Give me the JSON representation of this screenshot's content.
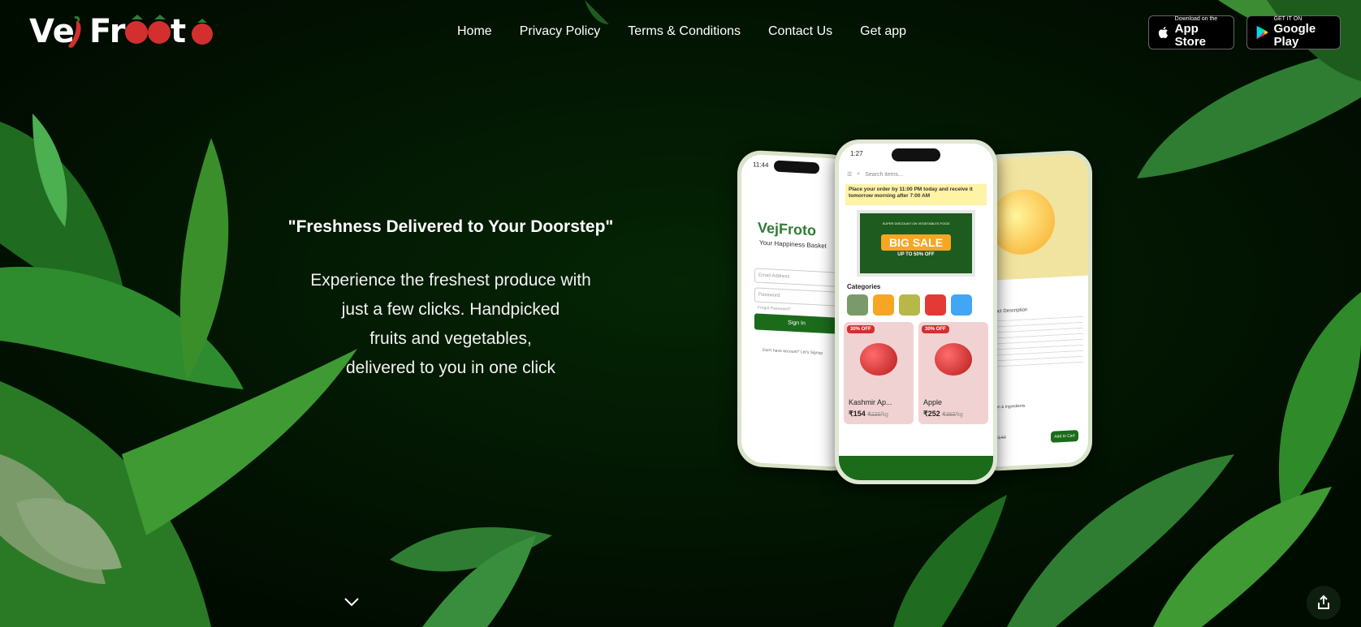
{
  "brand": {
    "name": "VejFroto"
  },
  "nav": {
    "items": [
      {
        "label": "Home"
      },
      {
        "label": "Privacy Policy"
      },
      {
        "label": "Terms & Conditions"
      },
      {
        "label": "Contact Us"
      },
      {
        "label": "Get app"
      }
    ]
  },
  "stores": {
    "apple": {
      "small": "Download on the",
      "big": "App Store"
    },
    "google": {
      "small": "GET IT ON",
      "big": "Google Play"
    }
  },
  "hero": {
    "title": "\"Freshness Delivered to Your Doorstep\"",
    "lines": [
      "Experience the freshest produce with",
      "just a few clicks. Handpicked",
      "fruits and vegetables,",
      "delivered to you in one click"
    ]
  },
  "phone_left": {
    "time": "11:44",
    "brand": "VejFroto",
    "tagline": "Your Happiness Basket",
    "email_placeholder": "Email Address",
    "password_placeholder": "Password",
    "forgot": "Forgot Password?",
    "signin": "Sign In",
    "footer": "Don't have account? Let's Signup"
  },
  "phone_center": {
    "time": "1:27",
    "search_placeholder": "Search items...",
    "notice": "Place your order by 11:00 PM today and receive it tomorrow morning after 7:00 AM",
    "sale_tagline": "SUPER DISCOUNT ON VEGETABLES FOOD",
    "sale_big": "BIG SALE",
    "sale_off": "UP TO 50% OFF",
    "categories_title": "Categories",
    "products": [
      {
        "badge": "30% OFF",
        "name": "Kashmir Ap...",
        "price": "₹154",
        "old_price": "₹220",
        "unit": "/kg"
      },
      {
        "badge": "30% OFF",
        "name": "Apple",
        "price": "₹252",
        "old_price": "₹360",
        "unit": "/kg"
      }
    ]
  },
  "phone_right": {
    "section1": "Product Description",
    "section2": "Nutrition & Ingredients",
    "add_to_cart": "Add to Cart",
    "price": "3",
    "old_price": "₹140"
  },
  "colors": {
    "background": "#021402",
    "leaf": "#2e7d32",
    "accent_green": "#1b6b1b",
    "badge_red": "#d32f2f"
  }
}
